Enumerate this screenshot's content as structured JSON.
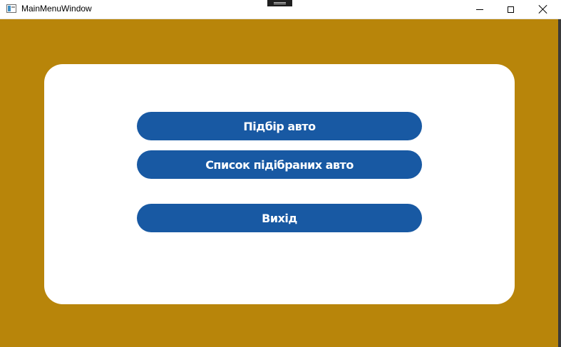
{
  "window": {
    "title": "MainMenuWindow",
    "controls": [
      "minimize-icon",
      "maximize-icon",
      "close-icon"
    ]
  },
  "colors": {
    "background": "#b8850a",
    "card": "#ffffff",
    "button": "#1859a3",
    "button_text": "#ffffff"
  },
  "menu": {
    "buttons": [
      {
        "label": "Підбір авто"
      },
      {
        "label": "Список підібраних авто"
      },
      {
        "label": "Вихід"
      }
    ]
  }
}
